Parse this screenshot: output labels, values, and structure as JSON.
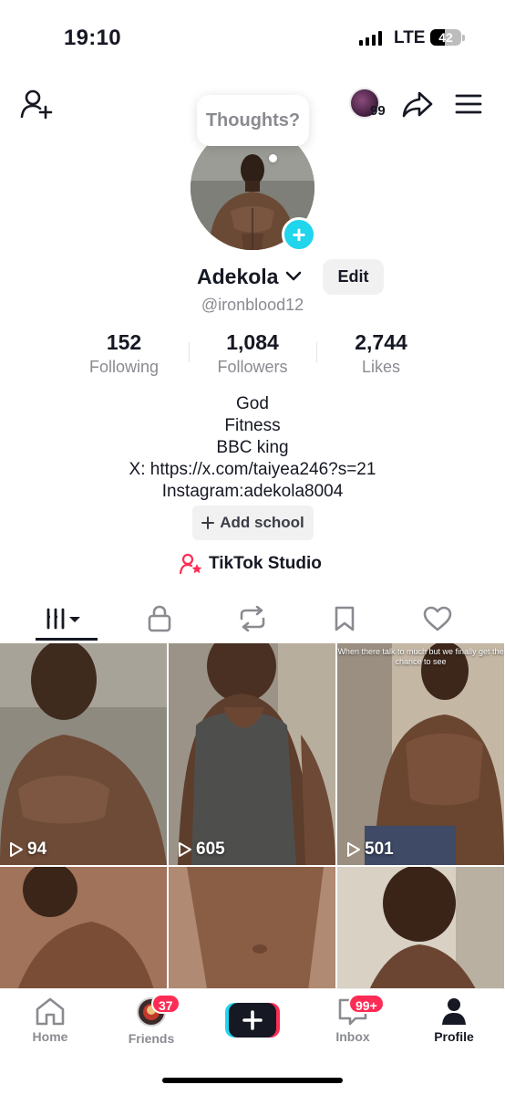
{
  "status_bar": {
    "time": "19:10",
    "network": "LTE",
    "battery": "42"
  },
  "header": {
    "story_count": "99",
    "thoughts_prompt": "Thoughts?"
  },
  "profile": {
    "display_name": "Adekola",
    "edit_label": "Edit",
    "handle": "@ironblood12",
    "stats": [
      {
        "value": "152",
        "label": "Following"
      },
      {
        "value": "1,084",
        "label": "Followers"
      },
      {
        "value": "2,744",
        "label": "Likes"
      }
    ],
    "bio": [
      "God",
      "Fitness",
      "BBC king",
      "X: https://x.com/taiyea246?s=21",
      "Instagram:adekola8004"
    ],
    "add_school_label": "Add school",
    "studio_label": "TikTok Studio"
  },
  "tabs": [
    {
      "icon": "videos-grid-icon",
      "active": true
    },
    {
      "icon": "lock-icon"
    },
    {
      "icon": "repost-icon"
    },
    {
      "icon": "bookmark-icon"
    },
    {
      "icon": "heart-icon"
    }
  ],
  "videos": [
    {
      "views": "94"
    },
    {
      "views": "605"
    },
    {
      "views": "501",
      "caption": "When there talk to much but we finally get the chance to see"
    },
    {
      "views": ""
    },
    {
      "views": ""
    },
    {
      "views": ""
    }
  ],
  "bottom_nav": {
    "home": "Home",
    "friends": "Friends",
    "friends_badge": "37",
    "inbox": "Inbox",
    "inbox_badge": "99+",
    "profile": "Profile"
  },
  "colors": {
    "accent_cyan": "#20d5ec",
    "accent_red": "#fe2c55",
    "text_muted": "#8a8b91"
  }
}
